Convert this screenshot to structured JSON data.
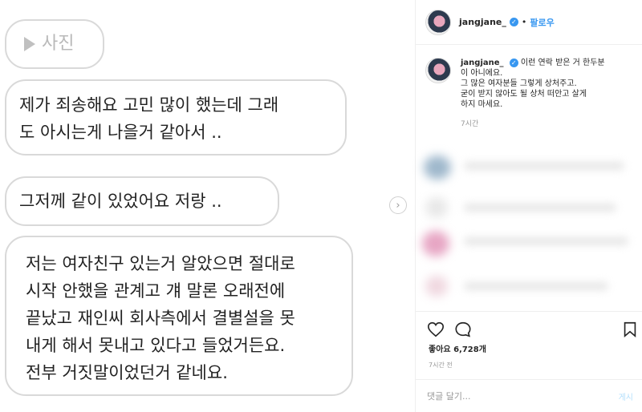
{
  "media": {
    "photo_label": "사진",
    "bubbles": {
      "b1": [
        "제가 죄송해요 고민 많이 했는데  그래",
        "도 아시는게 나을거 같아서 .."
      ],
      "b2": "그저께 같이 있었어요 저랑  ..",
      "b3": [
        "저는 여자친구 있는거 알았으면 절대로",
        "시작 안했을 관계고 걔 말론 오래전에",
        "끝났고 재인씨 회사측에서 결별설을 못",
        "내게 해서 못내고 있다고 들었거든요.",
        "전부 거짓말이었던거 같네요."
      ]
    }
  },
  "header": {
    "username": "jangjane_",
    "separator": "•",
    "follow_label": "팔로우"
  },
  "caption": {
    "username": "jangjane_",
    "first_line": "이런 연락 받은 거 한두분",
    "lines": [
      "이 아니에요.",
      "그 많은 여자분들 그렇게 상처주고.",
      "굳이 받지 않아도 될 상처 떠안고 살게",
      "하지 마세요."
    ],
    "time": "7시간"
  },
  "stats": {
    "likes": "좋아요 6,728개",
    "ago": "7시간 전"
  },
  "comment_box": {
    "placeholder": "댓글 달기...",
    "post_label": "게시"
  },
  "icons": {
    "like": "heart-icon",
    "comment": "comment-bubble-icon",
    "save": "bookmark-icon",
    "next": "chevron-right-icon",
    "verified": "verified-badge-icon",
    "play": "play-icon"
  },
  "colors": {
    "accent": "#3897f0",
    "post_disabled": "#b2dffc"
  }
}
